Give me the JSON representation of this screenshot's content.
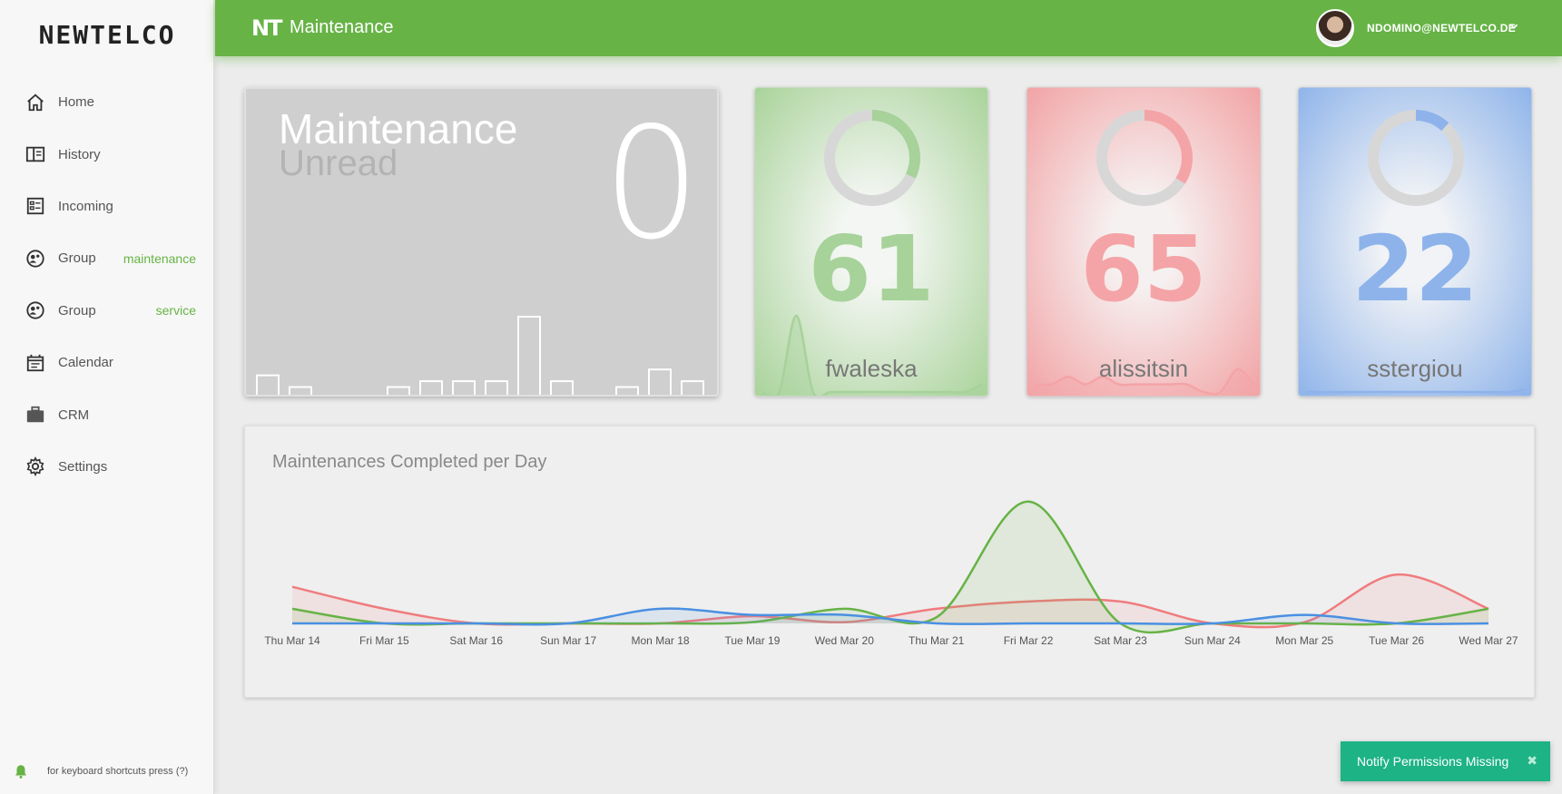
{
  "app": {
    "logo": "NEWTELCO"
  },
  "sidebar": {
    "items": [
      {
        "label": "Home",
        "icon": "home-icon",
        "sub": ""
      },
      {
        "label": "History",
        "icon": "book-icon",
        "sub": ""
      },
      {
        "label": "Incoming",
        "icon": "inbox-list-icon",
        "sub": ""
      },
      {
        "label": "Group",
        "icon": "group-icon",
        "sub": "maintenance"
      },
      {
        "label": "Group",
        "icon": "group-icon",
        "sub": "service"
      },
      {
        "label": "Calendar",
        "icon": "calendar-icon",
        "sub": ""
      },
      {
        "label": "CRM",
        "icon": "briefcase-icon",
        "sub": ""
      },
      {
        "label": "Settings",
        "icon": "gear-icon",
        "sub": ""
      }
    ],
    "footer_hint": "for keyboard shortcuts press (?)"
  },
  "header": {
    "logo": "NT",
    "title": "Maintenance",
    "user_email": "NDOMINO@NEWTELCO.DE",
    "brand_color": "#67b346"
  },
  "unread": {
    "title": "Maintenance",
    "subtitle": "Unread",
    "count": "0",
    "bars": [
      3,
      1,
      0,
      0,
      1,
      2,
      2,
      2,
      13,
      2,
      0,
      1,
      4,
      2
    ]
  },
  "people": [
    {
      "name": "fwaleska",
      "count": "61",
      "share": 0.32,
      "color": "#a7d29a",
      "spark": [
        0,
        0,
        10,
        0,
        0,
        0,
        0,
        0,
        0,
        0,
        0,
        0,
        0,
        1
      ]
    },
    {
      "name": "alissitsin",
      "count": "65",
      "share": 0.34,
      "color": "#f4a4a6",
      "spark": [
        1,
        1,
        2,
        1,
        2,
        1,
        1,
        1,
        1,
        1,
        0,
        0,
        3,
        1
      ]
    },
    {
      "name": "sstergiou",
      "count": "22",
      "share": 0.12,
      "color": "#8db3ea",
      "spark": [
        0,
        0,
        0,
        0,
        0,
        0,
        0,
        0,
        0,
        0,
        0,
        0,
        0,
        0.3
      ]
    }
  ],
  "completed_chart": {
    "title": "Maintenances Completed per Day"
  },
  "chart_data": {
    "type": "area",
    "categories": [
      "Thu Mar 14",
      "Fri Mar 15",
      "Sat Mar 16",
      "Sun Mar 17",
      "Mon Mar 18",
      "Tue Mar 19",
      "Wed Mar 20",
      "Thu Mar 21",
      "Fri Mar 22",
      "Sat Mar 23",
      "Sun Mar 24",
      "Mon Mar 25",
      "Tue Mar 26",
      "Wed Mar 27"
    ],
    "series": [
      {
        "color": "#ef7c7e",
        "values": [
          3,
          1.2,
          0,
          0,
          0,
          0.6,
          0.1,
          1.2,
          1.8,
          1.8,
          0,
          0.1,
          4,
          1.2
        ]
      },
      {
        "color": "#67b346",
        "values": [
          1.2,
          0,
          0,
          0,
          0,
          0.1,
          1.2,
          0.5,
          10,
          0,
          0,
          0,
          0,
          1.2
        ]
      },
      {
        "color": "#4a90e2",
        "values": [
          0,
          0,
          0,
          0,
          1.2,
          0.7,
          0.7,
          0,
          0,
          0,
          0,
          0.7,
          0,
          0
        ]
      }
    ],
    "ylim": [
      0,
      10.5
    ],
    "grid": false,
    "legend": "none"
  },
  "toast": {
    "text": "Notify Permissions Missing",
    "close": "✖"
  }
}
